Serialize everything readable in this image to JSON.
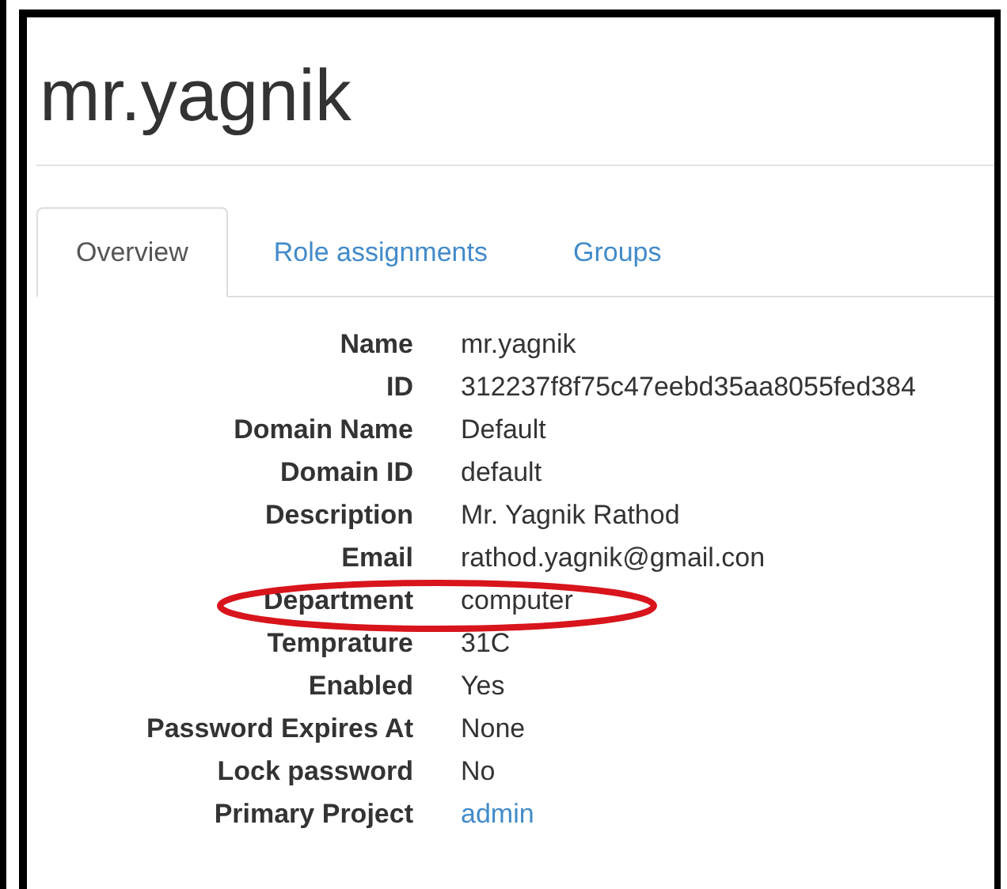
{
  "title": "mr.yagnik",
  "tabs": [
    {
      "label": "Overview",
      "selected": true
    },
    {
      "label": "Role assignments",
      "selected": false
    },
    {
      "label": "Groups",
      "selected": false
    }
  ],
  "details": [
    {
      "label": "Name",
      "value": "mr.yagnik",
      "kind": "text",
      "circled": false
    },
    {
      "label": "ID",
      "value": "312237f8f75c47eebd35aa8055fed384",
      "kind": "text",
      "circled": false
    },
    {
      "label": "Domain Name",
      "value": "Default",
      "kind": "text",
      "circled": false
    },
    {
      "label": "Domain ID",
      "value": "default",
      "kind": "text",
      "circled": false
    },
    {
      "label": "Description",
      "value": "Mr. Yagnik Rathod",
      "kind": "text",
      "circled": false
    },
    {
      "label": "Email",
      "value": "rathod.yagnik@gmail.con",
      "kind": "text",
      "circled": false
    },
    {
      "label": "Department",
      "value": "computer",
      "kind": "text",
      "circled": true
    },
    {
      "label": "Temprature",
      "value": "31C",
      "kind": "text",
      "circled": false
    },
    {
      "label": "Enabled",
      "value": "Yes",
      "kind": "text",
      "circled": false
    },
    {
      "label": "Password Expires At",
      "value": "None",
      "kind": "text",
      "circled": false
    },
    {
      "label": "Lock password",
      "value": "No",
      "kind": "text",
      "circled": false
    },
    {
      "label": "Primary Project",
      "value": "admin",
      "kind": "link",
      "circled": false
    }
  ]
}
